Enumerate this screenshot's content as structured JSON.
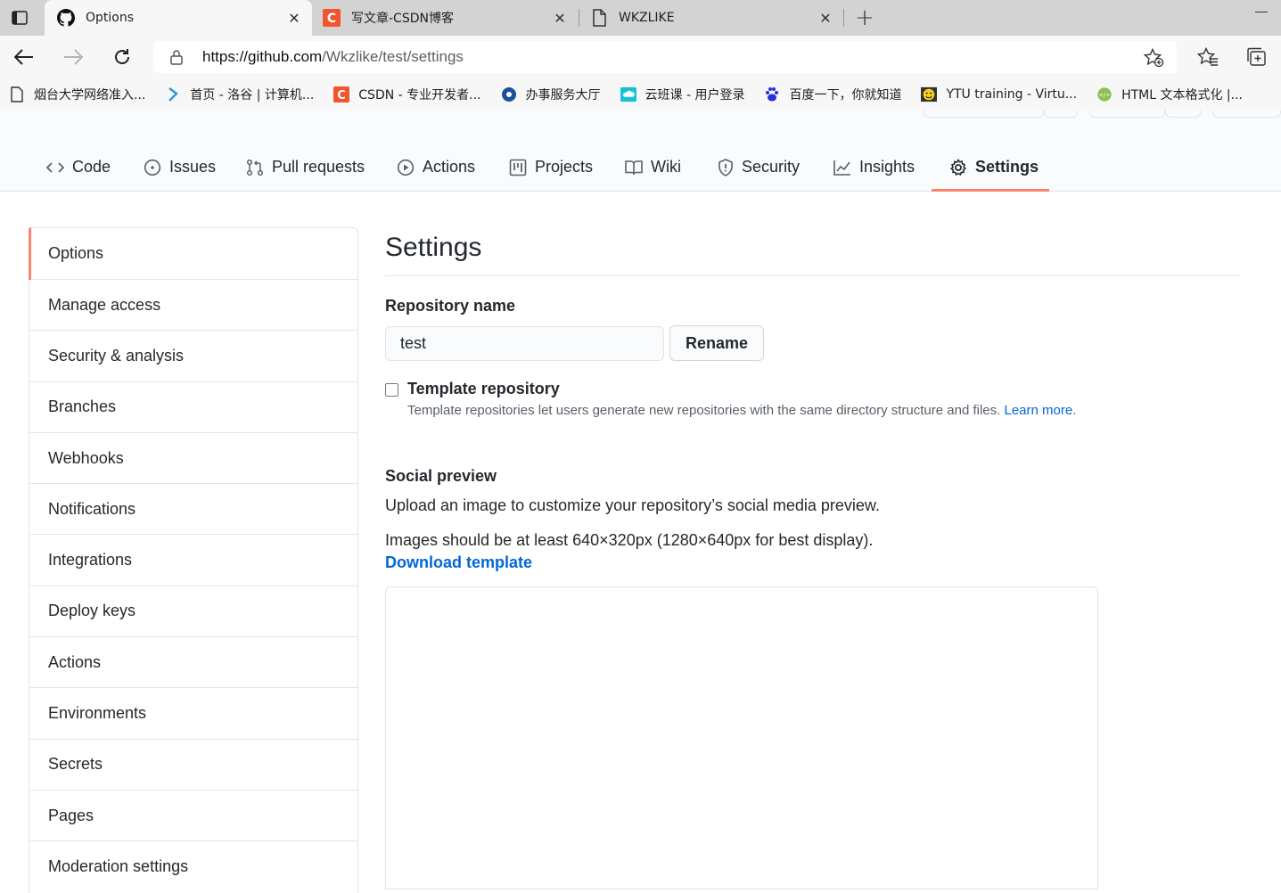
{
  "browser": {
    "tabs": [
      {
        "title": "Options",
        "icon": "github-icon",
        "active": true
      },
      {
        "title": "写文章-CSDN博客",
        "icon": "csdn-icon",
        "active": false
      },
      {
        "title": "WKZLIKE",
        "icon": "page-icon",
        "active": false
      }
    ],
    "close_glyph": "✕",
    "new_tab_glyph": "+",
    "url_host": "https://github.com",
    "url_path": "/Wkzlike/test/settings",
    "bookmarks": [
      {
        "label": "烟台大学网络准入...",
        "icon": "page-icon"
      },
      {
        "label": "首页 - 洛谷 | 计算机...",
        "icon": "luogu-icon"
      },
      {
        "label": "CSDN - 专业开发者...",
        "icon": "csdn-icon"
      },
      {
        "label": "办事服务大厅",
        "icon": "globe-icon"
      },
      {
        "label": "云班课 - 用户登录",
        "icon": "cloud-icon"
      },
      {
        "label": "百度一下，你就知道",
        "icon": "baidu-icon"
      },
      {
        "label": "YTU training - Virtu...",
        "icon": "smiley-icon"
      },
      {
        "label": "HTML 文本格式化 |...",
        "icon": "html-icon"
      }
    ]
  },
  "repo_nav": {
    "items": [
      {
        "label": "Code",
        "icon": "code-icon"
      },
      {
        "label": "Issues",
        "icon": "issue-icon"
      },
      {
        "label": "Pull requests",
        "icon": "pull-request-icon"
      },
      {
        "label": "Actions",
        "icon": "play-icon"
      },
      {
        "label": "Projects",
        "icon": "project-icon"
      },
      {
        "label": "Wiki",
        "icon": "book-icon"
      },
      {
        "label": "Security",
        "icon": "shield-icon"
      },
      {
        "label": "Insights",
        "icon": "graph-icon"
      },
      {
        "label": "Settings",
        "icon": "gear-icon",
        "selected": true
      }
    ],
    "accent": "#f9826c"
  },
  "sidebar": {
    "items": [
      {
        "label": "Options",
        "selected": true
      },
      {
        "label": "Manage access"
      },
      {
        "label": "Security & analysis"
      },
      {
        "label": "Branches"
      },
      {
        "label": "Webhooks"
      },
      {
        "label": "Notifications"
      },
      {
        "label": "Integrations"
      },
      {
        "label": "Deploy keys"
      },
      {
        "label": "Actions"
      },
      {
        "label": "Environments"
      },
      {
        "label": "Secrets"
      },
      {
        "label": "Pages"
      },
      {
        "label": "Moderation settings"
      }
    ]
  },
  "main": {
    "title": "Settings",
    "repo_name_label": "Repository name",
    "repo_name_value": "test",
    "rename_button": "Rename",
    "template_label": "Template repository",
    "template_checked": false,
    "template_note": "Template repositories let users generate new repositories with the same directory structure and files.",
    "learn_more": "Learn more",
    "learn_more_suffix": ".",
    "social_preview_label": "Social preview",
    "social_preview_desc": "Upload an image to customize your repository’s social media preview.",
    "image_hint": "Images should be at least 640×320px (1280×640px for best display).",
    "download_template": "Download template",
    "link_color": "#0366d6"
  }
}
